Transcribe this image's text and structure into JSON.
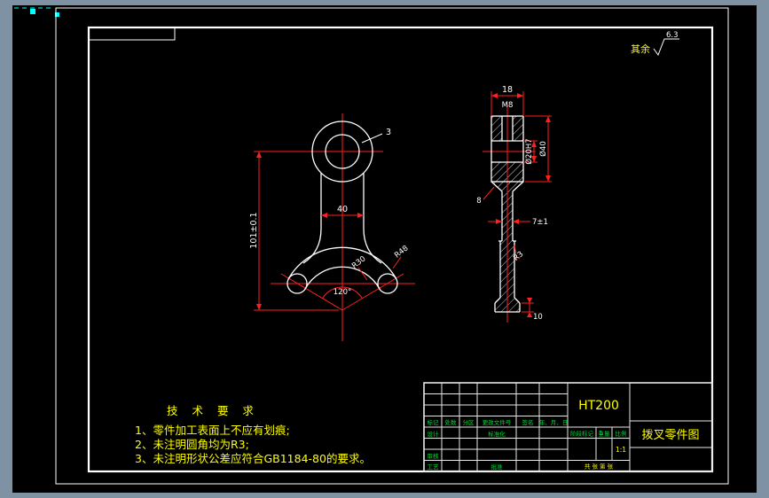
{
  "surface_note": {
    "label": "其余",
    "value": "6.3"
  },
  "tech_requirements": {
    "title": "技 术 要 求",
    "items": [
      "1、零件加工表面上不应有划痕;",
      "2、未注明圆角均为R3;",
      "3、未注明形状公差应符合GB1184-80的要求。"
    ]
  },
  "dimensions": {
    "front_width": "40",
    "front_height": "101±0.1",
    "wall": "3",
    "r_inner": "R30",
    "r_outer": "R48",
    "angle": "120°",
    "hub_width": "18",
    "thread": "M8",
    "bore": "Ø20H7",
    "hub_dia": "Ø40",
    "taper": "8",
    "stem_thk": "7±1",
    "fillet": "R3",
    "pad_thk": "10"
  },
  "title_block": {
    "material": "HT200",
    "drawing_name": "拨叉零件图",
    "scale_value": "1:1",
    "sheet_note": "共 张 第 张",
    "headers": [
      "标记",
      "处数",
      "分区",
      "更改文件号",
      "签名",
      "年、月、日"
    ],
    "design": "设计",
    "standardization": "标准化",
    "check": "审核",
    "process": "工艺",
    "approve": "批准",
    "stage": "阶段标记",
    "weight": "重量",
    "scale": "比例"
  },
  "colors": {
    "background": "#7e92a4",
    "canvas": "#000000",
    "outline": "#ffffff",
    "centerline": "#ff2020",
    "annotation": "#ffff00",
    "labels": "#00dd33",
    "grips": "#00ffff"
  }
}
